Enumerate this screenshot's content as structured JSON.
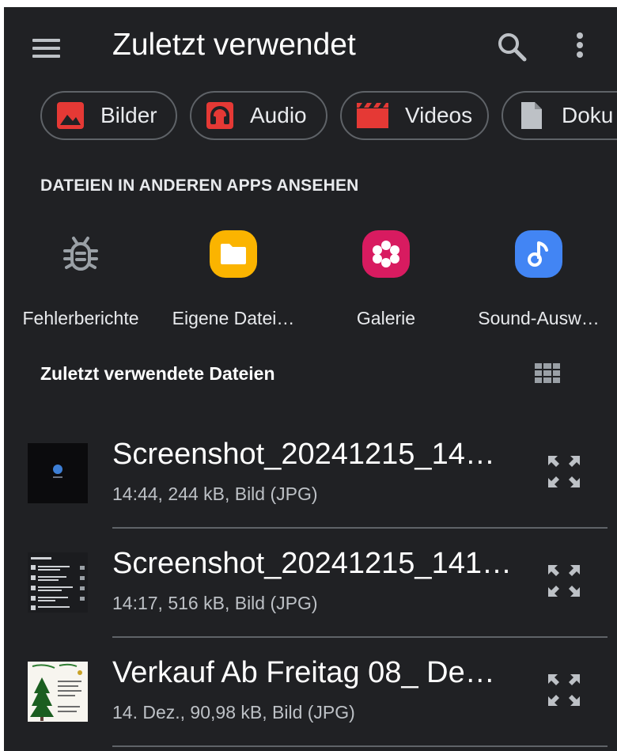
{
  "header": {
    "title": "Zuletzt verwendet",
    "menu_icon": "hamburger-menu-icon",
    "search_icon": "search-icon",
    "more_icon": "more-vert-icon"
  },
  "chips": [
    {
      "label": "Bilder",
      "icon": "image-icon",
      "color": "#e53935"
    },
    {
      "label": "Audio",
      "icon": "headphones-icon",
      "color": "#e53935"
    },
    {
      "label": "Videos",
      "icon": "clapperboard-icon",
      "color": "#e53935"
    },
    {
      "label": "Doku",
      "icon": "document-icon",
      "color": "#bdc1c6"
    }
  ],
  "other_apps": {
    "heading": "DATEIEN IN ANDEREN APPS ANSEHEN",
    "apps": [
      {
        "label": "Fehlerberichte",
        "icon": "bug-icon",
        "color": "#9aa0a6"
      },
      {
        "label": "Eigene Datei…",
        "icon": "folder-icon",
        "color": "#fbb400"
      },
      {
        "label": "Galerie",
        "icon": "flower-icon",
        "color": "#d81b60"
      },
      {
        "label": "Sound-Ausw…",
        "icon": "music-note-icon",
        "color": "#4285f4"
      }
    ]
  },
  "recent": {
    "heading": "Zuletzt verwendete Dateien",
    "view_icon": "grid-view-icon",
    "files": [
      {
        "name": "Screenshot_20241215_14…",
        "meta": "14:44, 244 kB, Bild (JPG)",
        "thumb": "dark-screenshot-thumbnail"
      },
      {
        "name": "Screenshot_20241215_141…",
        "meta": "14:17, 516 kB, Bild (JPG)",
        "thumb": "list-screenshot-thumbnail"
      },
      {
        "name": "Verkauf Ab Freitag 08_ De…",
        "meta": "14. Dez., 90,98 kB, Bild (JPG)",
        "thumb": "christmas-flyer-thumbnail"
      }
    ]
  },
  "colors": {
    "background": "#202124",
    "text": "#e8eaed",
    "secondary_text": "#bdc1c6",
    "outline": "#5f6368"
  }
}
